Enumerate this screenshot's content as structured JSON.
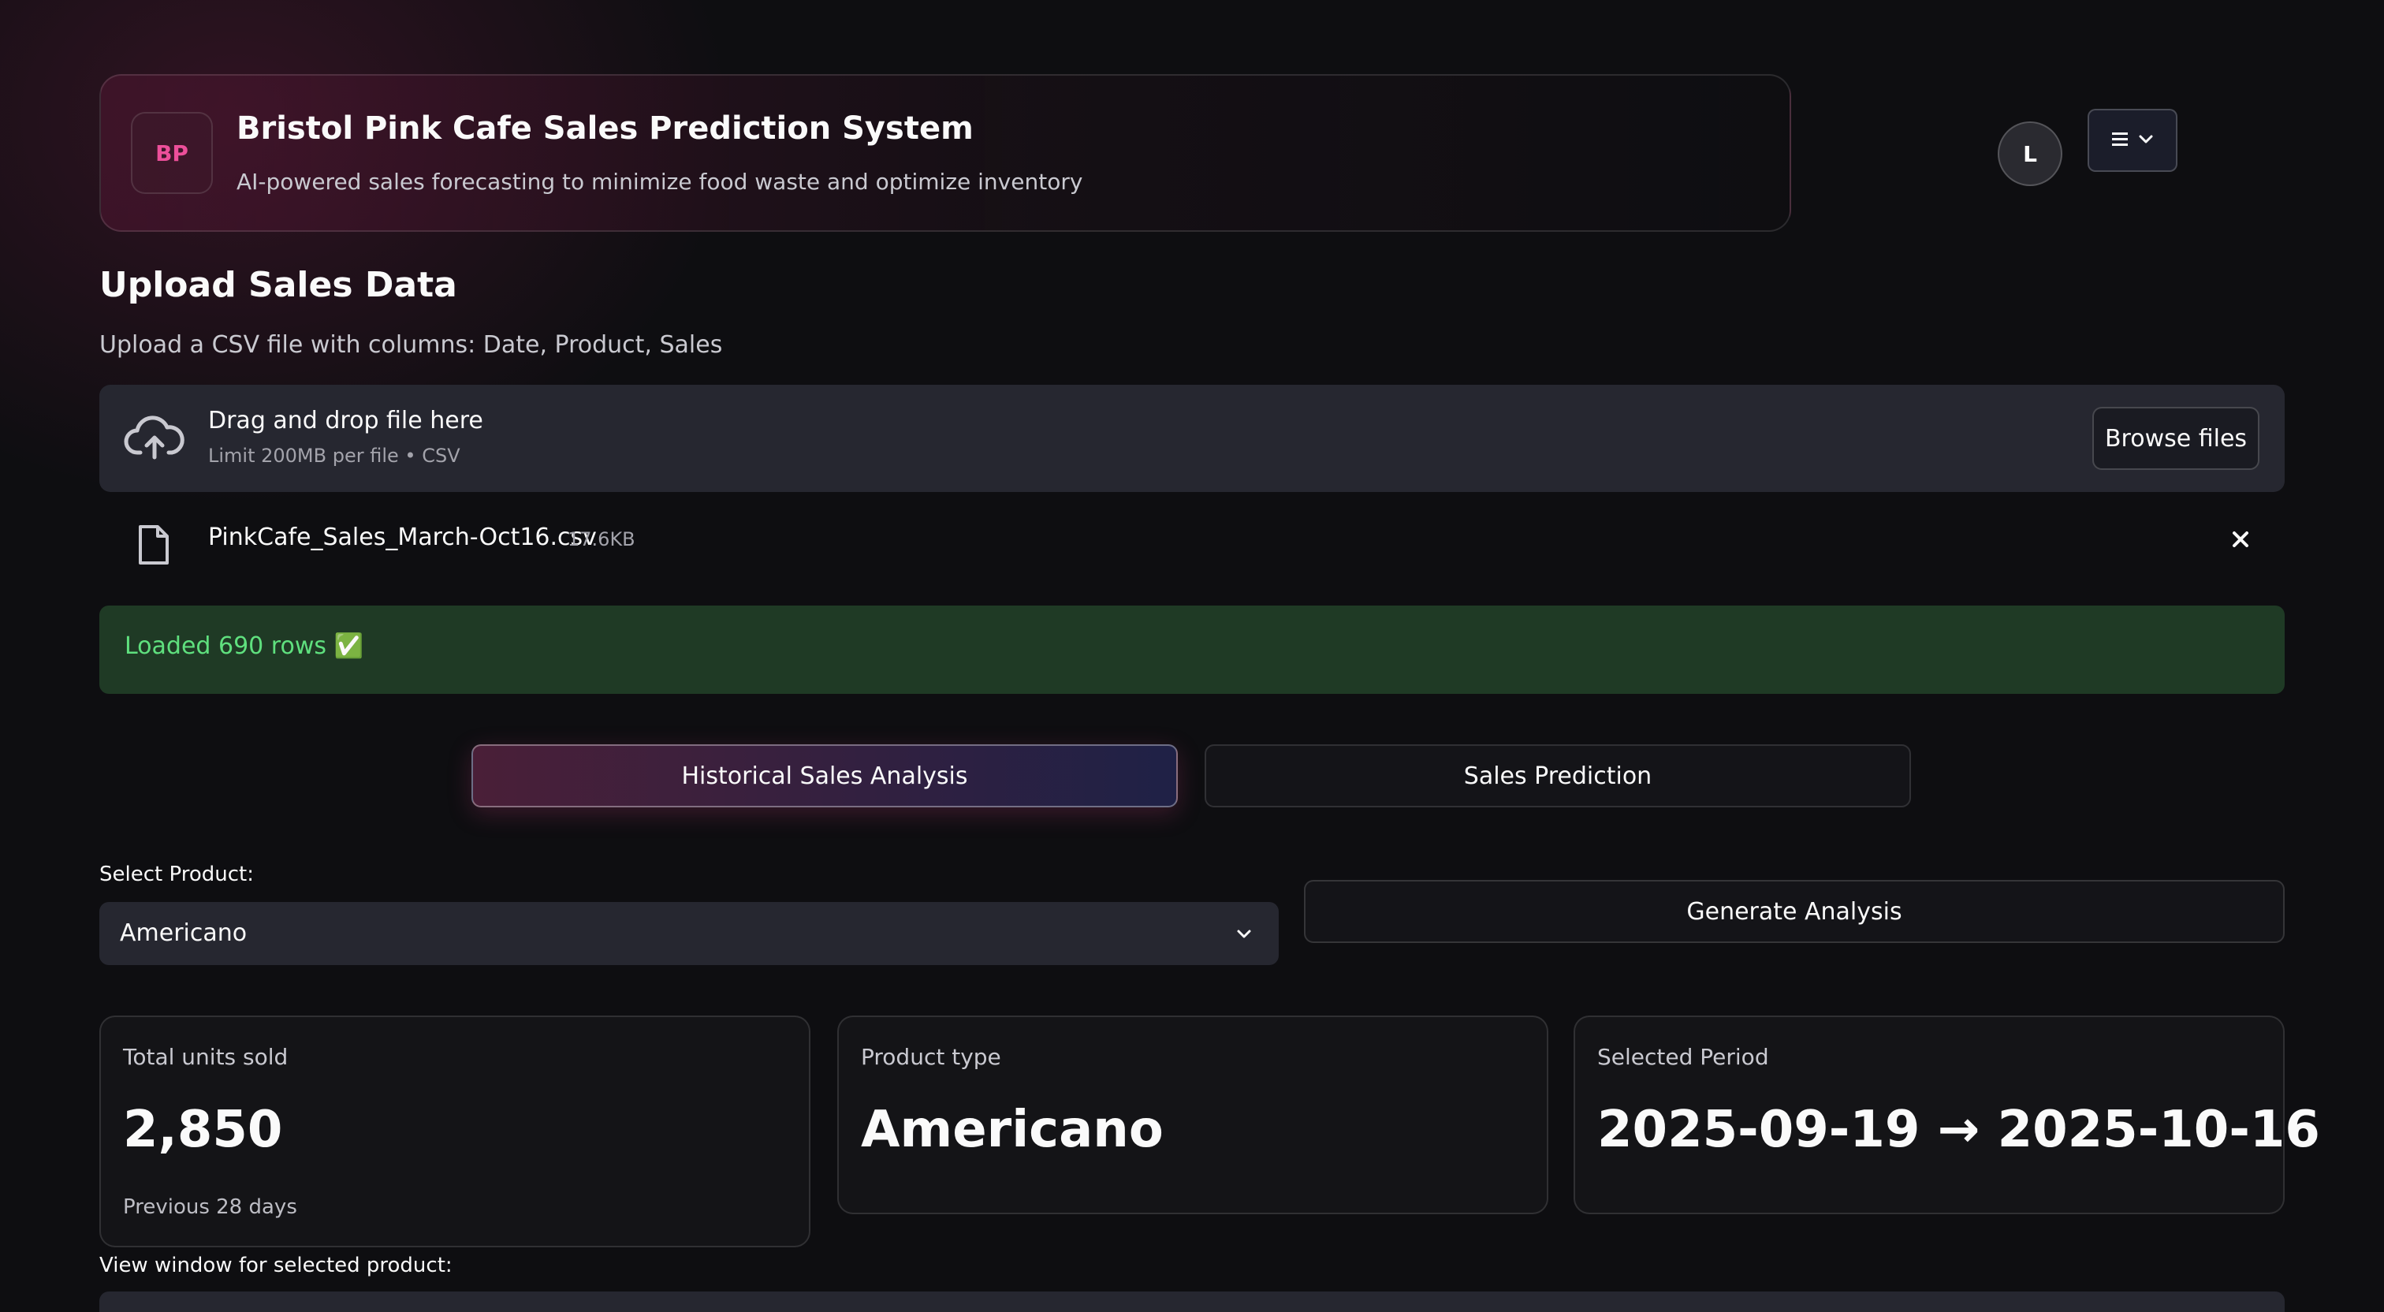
{
  "header": {
    "logo_text": "BP",
    "title": "Bristol Pink Cafe Sales Prediction System",
    "subtitle": "AI-powered sales forecasting to minimize food waste and optimize inventory"
  },
  "user": {
    "avatar_initial": "L"
  },
  "upload": {
    "heading": "Upload Sales Data",
    "description": "Upload a CSV file with columns: Date, Product, Sales",
    "dropzone_title": "Drag and drop file here",
    "dropzone_limit": "Limit 200MB per file • CSV",
    "browse_label": "Browse files",
    "file": {
      "name": "PinkCafe_Sales_March-Oct16.csv",
      "size": "17.6KB"
    }
  },
  "alert": {
    "text": "Loaded 690 rows ✅",
    "color": "#5fe07e"
  },
  "tabs": [
    {
      "label": "Historical Sales Analysis",
      "active": true
    },
    {
      "label": "Sales Prediction",
      "active": false
    }
  ],
  "controls": {
    "select_label": "Select Product:",
    "selected_product": "Americano",
    "generate_label": "Generate Analysis"
  },
  "metrics": [
    {
      "label": "Total units sold",
      "value": "2,850",
      "footnote": "Previous 28 days"
    },
    {
      "label": "Product type",
      "value": "Americano"
    },
    {
      "label": "Selected Period",
      "value": "2025-09-19 → 2025-10-16"
    }
  ],
  "view_window_label": "View window for selected product:",
  "colors": {
    "accent": "#ec4f9a",
    "background": "#0e0e11",
    "success_bg": "#1f3a25"
  }
}
